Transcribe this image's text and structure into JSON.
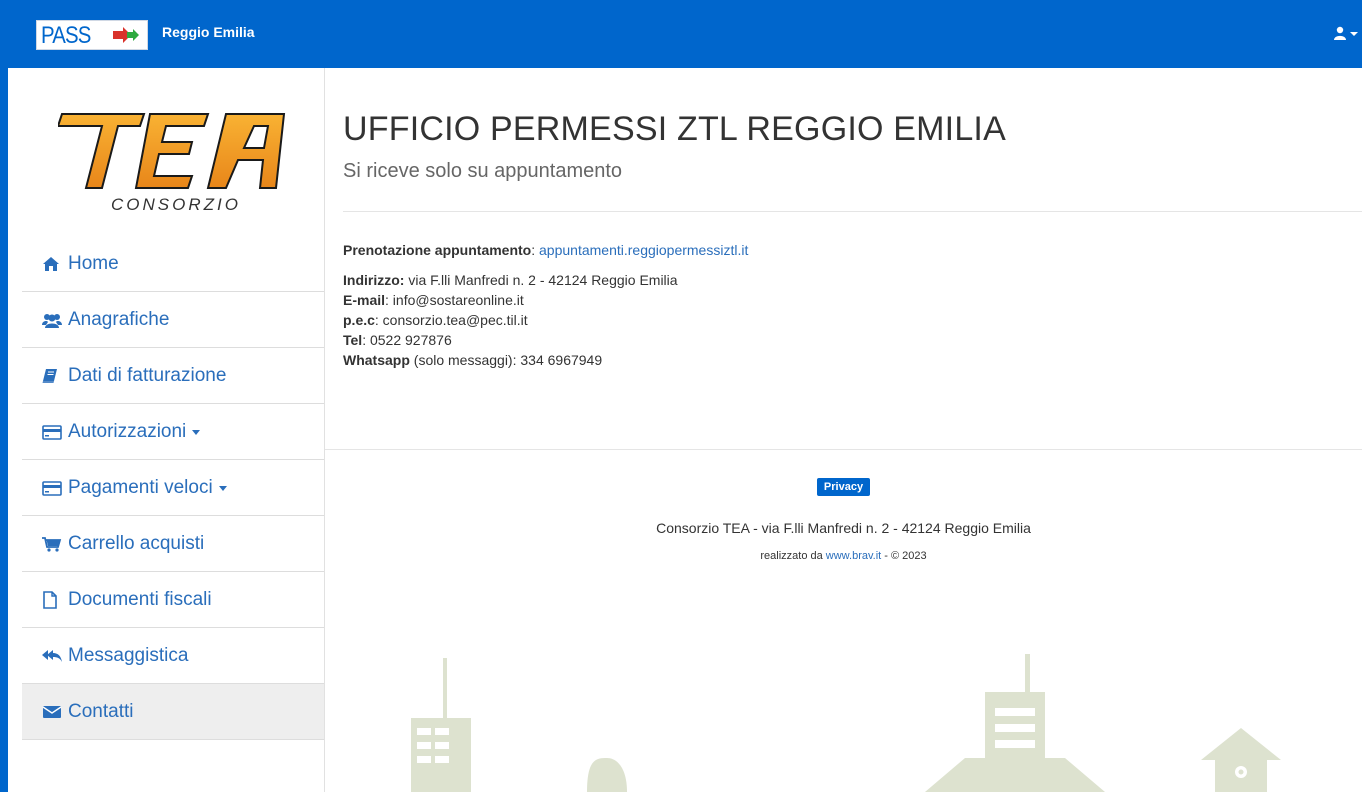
{
  "header": {
    "logo_text": "PASS",
    "city": "Reggio Emilia",
    "brand_color": "#0066cc"
  },
  "sidebar": {
    "logo": {
      "main": "TEA",
      "sub": "CONSORZIO"
    },
    "items": [
      {
        "label": "Home",
        "icon": "home-icon"
      },
      {
        "label": "Anagrafiche",
        "icon": "users-icon"
      },
      {
        "label": "Dati di fatturazione",
        "icon": "book-icon"
      },
      {
        "label": "Autorizzazioni",
        "icon": "card-icon",
        "dropdown": true
      },
      {
        "label": "Pagamenti veloci",
        "icon": "card-icon",
        "dropdown": true
      },
      {
        "label": "Carrello acquisti",
        "icon": "cart-icon"
      },
      {
        "label": "Documenti fiscali",
        "icon": "file-icon"
      },
      {
        "label": "Messaggistica",
        "icon": "reply-all-icon"
      },
      {
        "label": "Contatti",
        "icon": "envelope-icon",
        "active": true
      }
    ]
  },
  "main": {
    "title": "UFFICIO PERMESSI ZTL REGGIO EMILIA",
    "subtitle": "Si riceve solo su appuntamento",
    "booking_label": "Prenotazione appuntamento",
    "booking_link": "appuntamenti.reggiopermessiztl.it",
    "address_label": "Indirizzo:",
    "address_value": " via F.lli Manfredi n. 2 - 42124 Reggio Emilia",
    "email_label": "E-mail",
    "email_value": ": info@sostareonline.it",
    "pec_label": "p.e.c",
    "pec_value": ": consorzio.tea@pec.til.it",
    "tel_label": "Tel",
    "tel_value": ": 0522 927876",
    "whatsapp_label": "Whatsapp",
    "whatsapp_value": " (solo messaggi): 334 6967949"
  },
  "footer": {
    "privacy_label": "Privacy",
    "address": "Consorzio TEA - via F.lli Manfredi n. 2 - 42124 Reggio Emilia",
    "credit_prefix": "realizzato da ",
    "credit_link": "www.brav.it",
    "credit_suffix": " - © 2023"
  }
}
